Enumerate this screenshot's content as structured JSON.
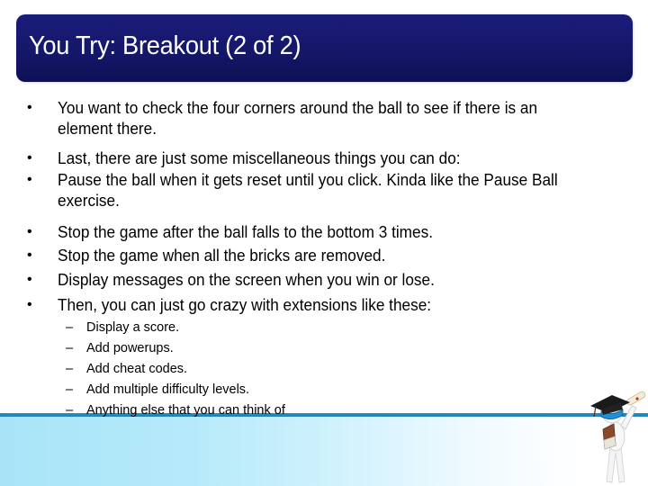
{
  "slide": {
    "title": "You Try: Breakout (2 of 2)",
    "bullets": [
      {
        "mark": "•",
        "text": "You want to check the four corners around the ball to see if there is an element there."
      },
      {
        "mark": "•",
        "text": "Last, there are just some miscellaneous things you can do:"
      },
      {
        "mark": "•",
        "text": "Pause the ball when it gets reset until you click. Kinda like the Pause Ball exercise."
      },
      {
        "mark": "•",
        "text": "Stop the game after the ball falls to the bottom 3 times."
      },
      {
        "mark": "•",
        "text": "Stop the game when all the bricks are removed."
      },
      {
        "mark": "•",
        "text": "Display messages on the screen when you win or lose."
      },
      {
        "mark": "•",
        "text": "Then, you can just go crazy with extensions like these:"
      }
    ],
    "sub_bullets": [
      {
        "mark": "–",
        "text": "Display a score."
      },
      {
        "mark": "–",
        "text": "Add powerups."
      },
      {
        "mark": "–",
        "text": "Add cheat codes."
      },
      {
        "mark": "–",
        "text": "Add multiple difficulty levels."
      },
      {
        "mark": "–",
        "text": "Anything else that you can think of"
      }
    ],
    "decoration": {
      "mascot_icon": "graduate-figure-with-diploma-icon"
    },
    "colors": {
      "title_bar": "#15176a",
      "title_text": "#ffffff",
      "band_line": "#2c8ec4",
      "band_gradient_start": "#a8e4f8"
    }
  }
}
